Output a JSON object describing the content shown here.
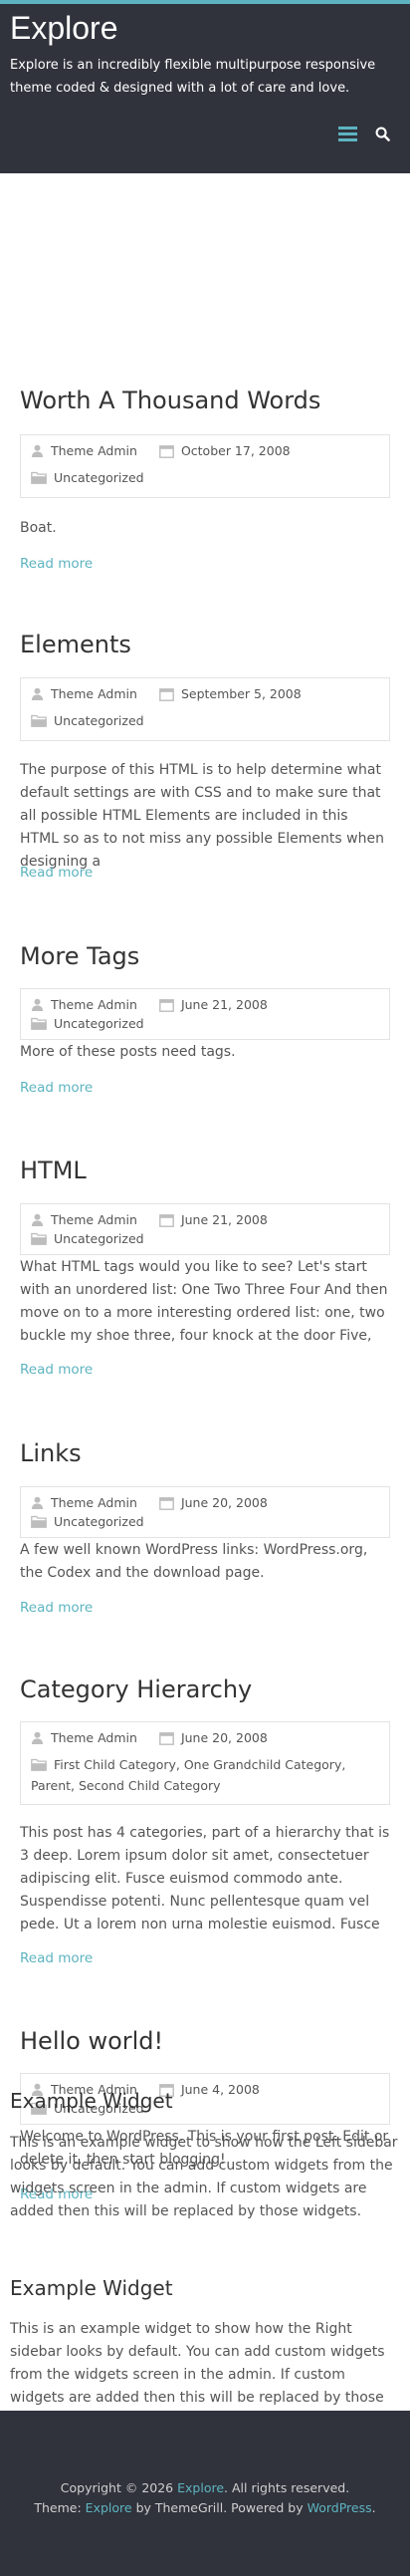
{
  "site": {
    "title": "Explore",
    "description": "Explore is an incredibly flexible multipurpose responsive theme coded & designed with a lot of care and love."
  },
  "colors": {
    "accent": "#5db4c0",
    "header_bg": "#30333c"
  },
  "icons": {
    "menu": "menu-icon",
    "search": "search-icon",
    "author": "user-icon",
    "date": "calendar-icon",
    "category": "folder-icon"
  },
  "posts": [
    {
      "title": "Worth A Thousand Words",
      "author": "Theme Admin",
      "date": "October 17, 2008",
      "categories": "Uncategorized",
      "excerpt": "Boat.",
      "read_more": "Read more"
    },
    {
      "title": "Elements",
      "author": "Theme Admin",
      "date": "September 5, 2008",
      "categories": "Uncategorized",
      "excerpt": "The purpose of this HTML is to help determine what default settings are with CSS and to make sure that all possible HTML Elements are included in this HTML so as to not miss any possible Elements when designing a",
      "read_more": "Read more"
    },
    {
      "title": "More Tags",
      "author": "Theme Admin",
      "date": "June 21, 2008",
      "categories": "Uncategorized",
      "excerpt": "More of these posts need tags.",
      "read_more": "Read more"
    },
    {
      "title": "HTML",
      "author": "Theme Admin",
      "date": "June 21, 2008",
      "categories": "Uncategorized",
      "excerpt": "What HTML tags would you like to see? Let's start with an unordered list: One Two Three Four And then move on to a more interesting ordered list: one, two buckle my shoe three, four knock at the door Five,",
      "read_more": "Read more"
    },
    {
      "title": "Links",
      "author": "Theme Admin",
      "date": "June 20, 2008",
      "categories": "Uncategorized",
      "excerpt": "A few well known WordPress links: WordPress.org, the Codex and the download page.",
      "read_more": "Read more"
    },
    {
      "title": "Category Hierarchy",
      "author": "Theme Admin",
      "date": "June 20, 2008",
      "categories": "First Child Category, One Grandchild Category, Parent, Second Child Category",
      "excerpt": "This post has 4 categories, part of a hierarchy that is 3 deep. Lorem ipsum dolor sit amet, consectetuer adipiscing elit. Fusce euismod commodo ante. Suspendisse potenti. Nunc pellentesque quam vel pede. Ut a lorem non urna molestie euismod. Fusce",
      "read_more": "Read more"
    },
    {
      "title": "Hello world!",
      "author": "Theme Admin",
      "date": "June 4, 2008",
      "categories": "Uncategorized",
      "excerpt": "Welcome to WordPress. This is your first post. Edit or delete it, then start blogging!",
      "read_more": "Read more"
    }
  ],
  "widgets": [
    {
      "title": "Example Widget",
      "text": "This is an example widget to show how the Left sidebar looks by default. You can add custom widgets from the widgets screen in the admin. If custom widgets are added then this will be replaced by those widgets."
    },
    {
      "title": "Example Widget",
      "text": "This is an example widget to show how the Right sidebar looks by default. You can add custom widgets from the widgets screen in the admin. If custom widgets are added then this will be replaced by those widgets."
    }
  ],
  "footer": {
    "copyright_prefix": "Copyright © 2026",
    "site_link": "Explore",
    "rights": ". All rights reserved.",
    "theme_prefix": "Theme:",
    "theme_link": "Explore",
    "by": "by ThemeGrill. Powered by",
    "wp_link": "WordPress",
    "end": "."
  }
}
